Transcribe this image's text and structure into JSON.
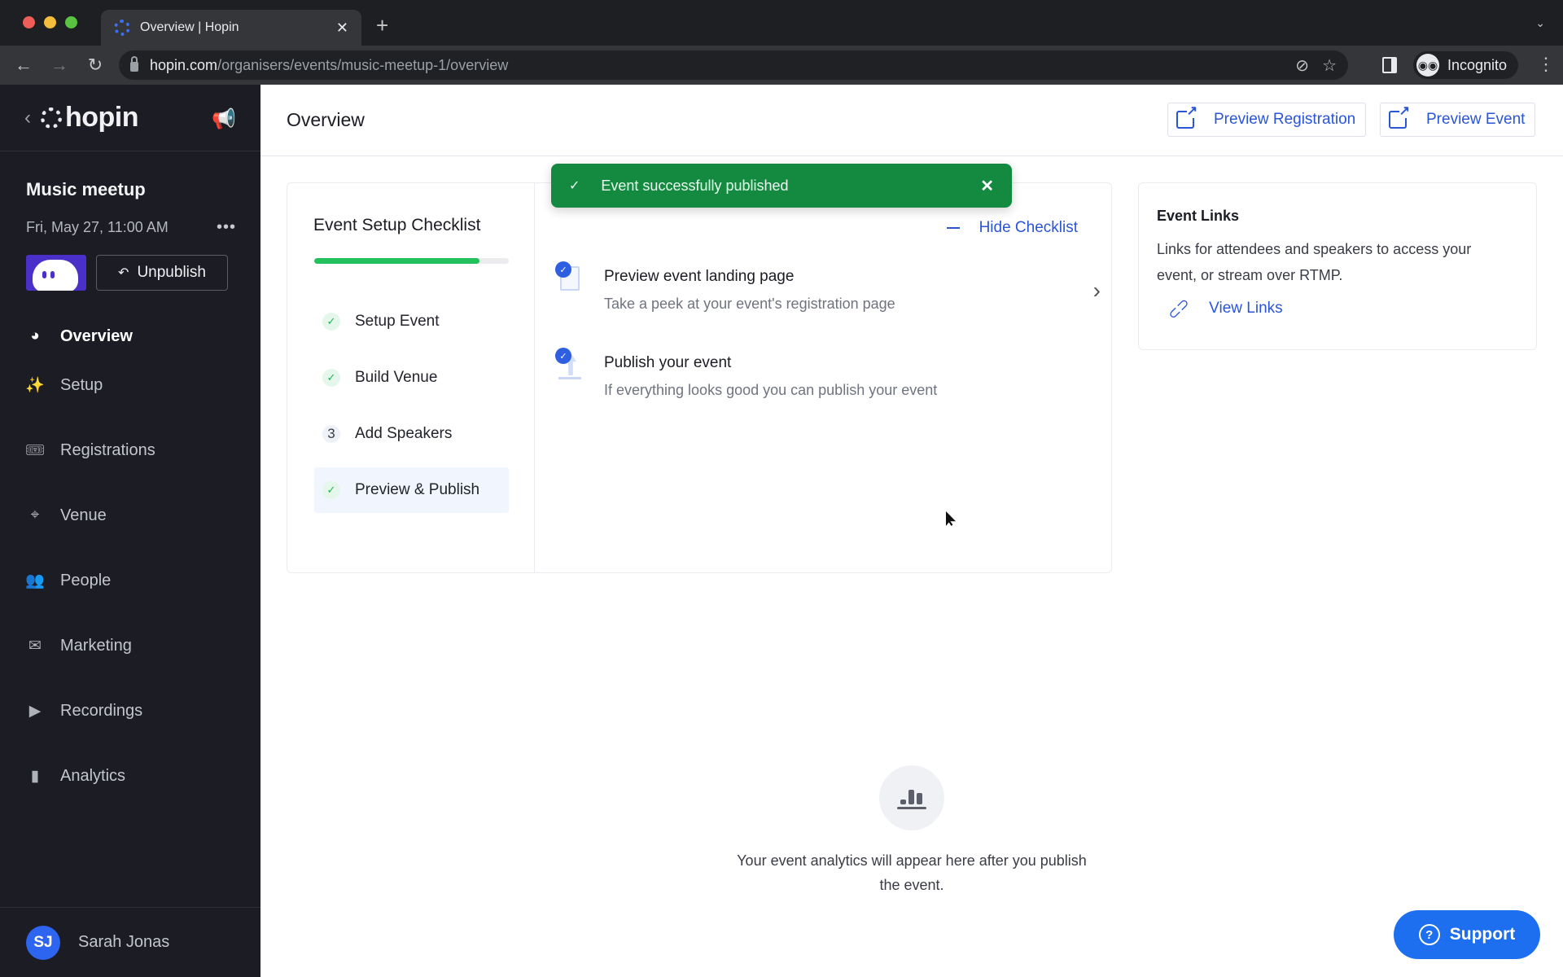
{
  "browser": {
    "tab_title": "Overview | Hopin",
    "url_host": "hopin.com",
    "url_path": "/organisers/events/music-meetup-1/overview",
    "profile_label": "Incognito"
  },
  "sidebar": {
    "logo_text": "hopin",
    "event_name": "Music meetup",
    "event_date": "Fri, May 27, 11:00 AM",
    "unpublish_label": "Unpublish",
    "nav": [
      {
        "label": "Overview",
        "icon": "pie-chart-icon",
        "active": true
      },
      {
        "label": "Setup",
        "icon": "magic-wand-icon"
      },
      {
        "label": "Registrations",
        "icon": "ticket-icon"
      },
      {
        "label": "Venue",
        "icon": "map-pin-icon"
      },
      {
        "label": "People",
        "icon": "people-icon"
      },
      {
        "label": "Marketing",
        "icon": "envelope-icon"
      },
      {
        "label": "Recordings",
        "icon": "video-icon"
      },
      {
        "label": "Analytics",
        "icon": "bar-chart-icon"
      }
    ],
    "user": {
      "initials": "SJ",
      "name": "Sarah Jonas"
    }
  },
  "header": {
    "title": "Overview",
    "preview_registration": "Preview Registration",
    "preview_event": "Preview Event"
  },
  "toast": {
    "message": "Event successfully published",
    "color": "#148a41"
  },
  "checklist": {
    "title": "Event Setup Checklist",
    "progress_percent": 85,
    "hide_label": "Hide Checklist",
    "steps": [
      {
        "label": "Setup Event",
        "status": "done"
      },
      {
        "label": "Build Venue",
        "status": "done"
      },
      {
        "label": "Add Speakers",
        "status": "pending",
        "number": "3"
      },
      {
        "label": "Preview & Publish",
        "status": "done",
        "active": true
      }
    ],
    "tasks": [
      {
        "title": "Preview event landing page",
        "desc": "Take a peek at your event's registration page",
        "done": true
      },
      {
        "title": "Publish your event",
        "desc": "If everything looks good you can publish your event",
        "done": true
      }
    ]
  },
  "event_links": {
    "title": "Event Links",
    "desc": "Links for attendees and speakers to access your event, or stream over RTMP.",
    "link_label": "View Links"
  },
  "analytics": {
    "empty_text": "Your event analytics will appear here after you publish the event."
  },
  "support": {
    "label": "Support"
  },
  "colors": {
    "accent": "#2a55d6",
    "success": "#23c15e",
    "sidebar_bg": "#1b1c24"
  }
}
